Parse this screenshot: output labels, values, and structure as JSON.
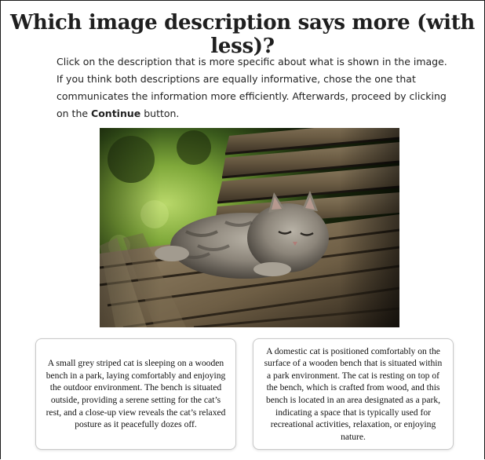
{
  "page": {
    "title": "Which image description says more (with less)?",
    "instructions": {
      "text_before": "Click on the description that is more specific about what is shown in the image. If you think both descriptions are equally informative, chose the one that communicates the information more efficiently. Afterwards, proceed by clicking on the ",
      "bold": "Continue",
      "text_after": " button."
    }
  },
  "image": {
    "subject": "cat-sleeping-on-wooden-bench"
  },
  "descriptions": [
    {
      "text": "A small grey striped cat is sleeping on a wooden bench in a park, laying comfortably and enjoying the outdoor environment. The bench is situated outside, providing a serene setting for the cat’s rest, and a close-up view reveals the cat’s relaxed posture as it peacefully dozes off."
    },
    {
      "text": "A domestic cat is positioned comfortably on the surface of a wooden bench that is situated within a park environment. The cat is resting on top of the bench, which is crafted from wood, and this bench is located in an area designated as a park, indicating a space that is typically used for recreational activities, relaxation, or enjoying nature."
    }
  ],
  "colors": {
    "frame_border": "#1a1a1a",
    "card_border": "#c9c9c9",
    "text": "#222222"
  }
}
